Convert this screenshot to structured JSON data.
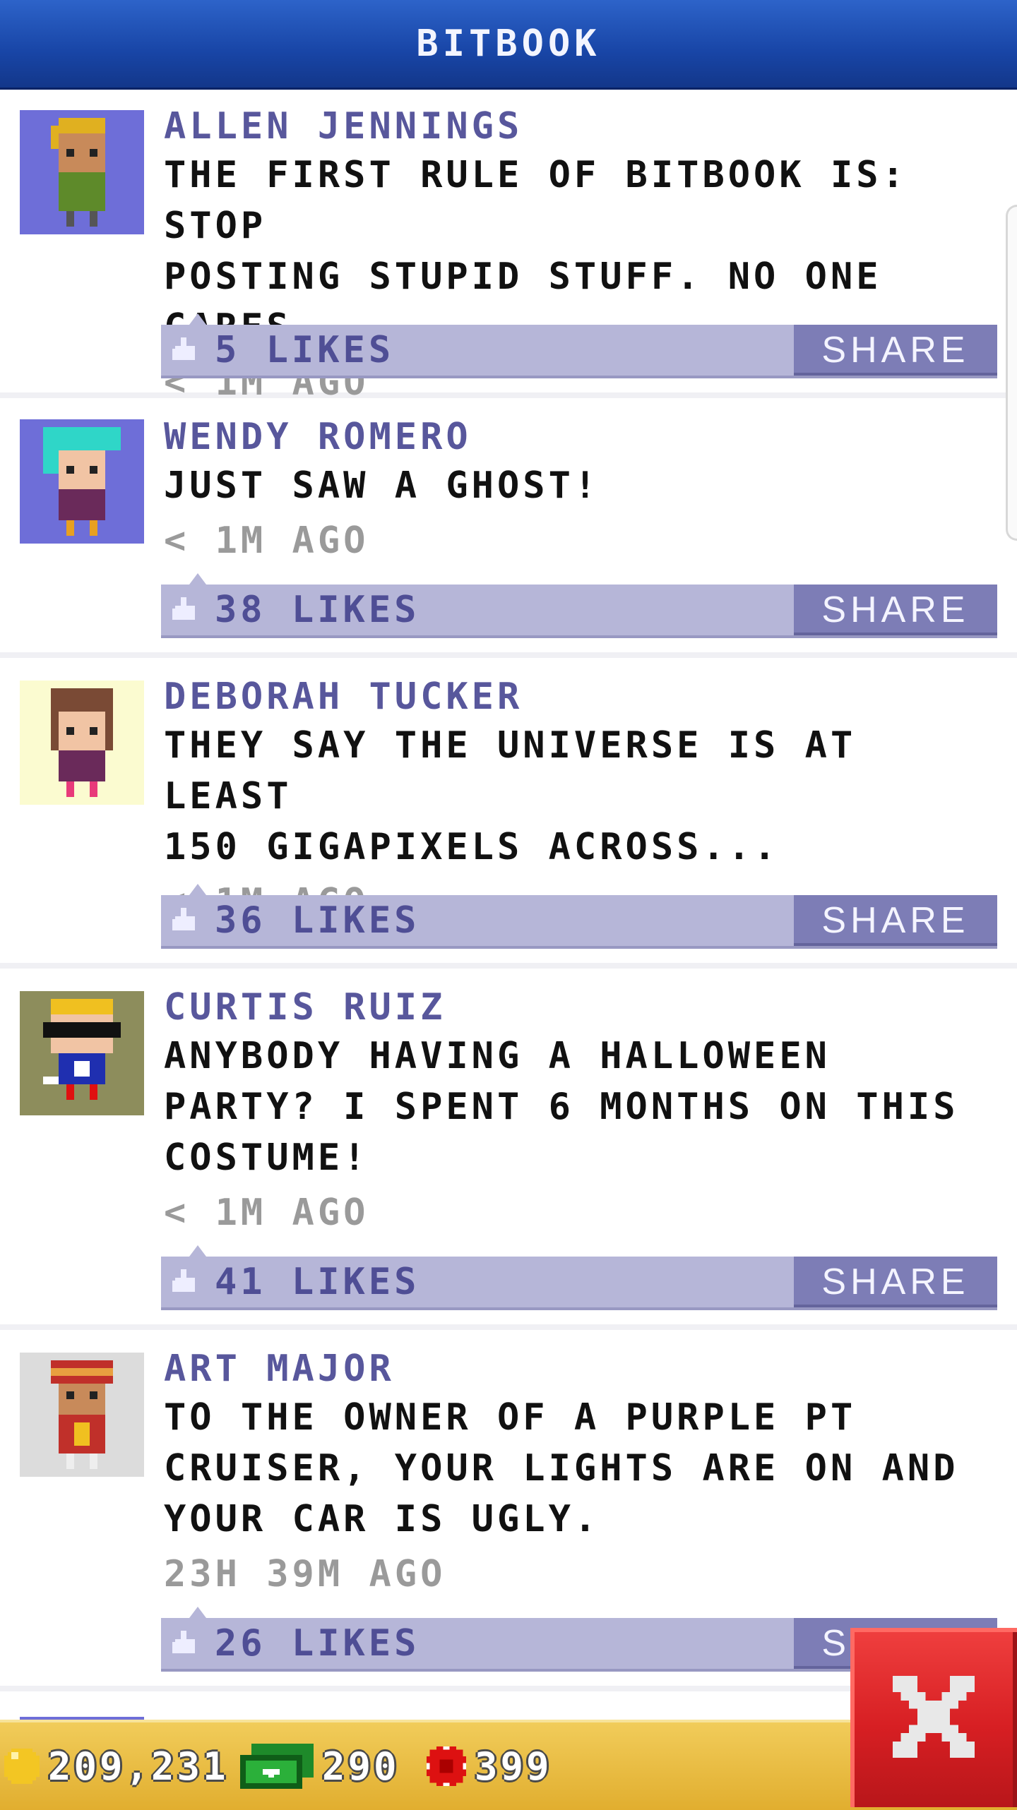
{
  "header": {
    "title": "BITBOOK"
  },
  "posts": [
    {
      "author": "ALLEN JENNINGS",
      "text": "THE FIRST RULE OF BITBOOK IS: STOP\nPOSTING STUPID STUFF. NO ONE CARES.",
      "time": "< 1M AGO",
      "likes": "5 LIKES",
      "share": "SHARE",
      "avatar_bg": "#6e6ed8",
      "avatar_icon": "bitizen-avatar"
    },
    {
      "author": "WENDY ROMERO",
      "text": "JUST SAW A GHOST!",
      "time": "< 1M AGO",
      "likes": "38 LIKES",
      "share": "SHARE",
      "avatar_bg": "#6e6ed8",
      "avatar_icon": "bitizen-avatar"
    },
    {
      "author": "DEBORAH TUCKER",
      "text": "THEY SAY THE UNIVERSE IS AT LEAST\n150 GIGAPIXELS ACROSS...",
      "time": "< 1M AGO",
      "likes": "36 LIKES",
      "share": "SHARE",
      "avatar_bg": "#fbfbd0",
      "avatar_icon": "bitizen-avatar"
    },
    {
      "author": "CURTIS RUIZ",
      "text": "ANYBODY HAVING A HALLOWEEN\nPARTY? I SPENT 6 MONTHS ON THIS\nCOSTUME!",
      "time": "< 1M AGO",
      "likes": "41 LIKES",
      "share": "SHARE",
      "avatar_bg": "#8d8d5c",
      "avatar_icon": "bitizen-avatar"
    },
    {
      "author": "ART MAJOR",
      "text": "TO THE OWNER OF A PURPLE PT\nCRUISER, YOUR LIGHTS ARE ON AND\nYOUR CAR IS UGLY.",
      "time": "23H 39M AGO",
      "likes": "26 LIKES",
      "share": "SHARE",
      "avatar_bg": "#dcdcdc",
      "avatar_icon": "bitizen-avatar"
    }
  ],
  "status": {
    "coins": "209,231",
    "bux": "290",
    "tokens": "399"
  },
  "icons": {
    "coins": "coin-icon",
    "bux": "bux-icon",
    "tokens": "token-icon",
    "close": "close-icon",
    "like": "thumbs-up-icon"
  },
  "colors": {
    "header": "#1c4db3",
    "author": "#58579c",
    "like_bar": "#b6b6d8",
    "share": "#7d7db6",
    "close": "#d71f23",
    "status_bar": "#e8bb3e"
  }
}
